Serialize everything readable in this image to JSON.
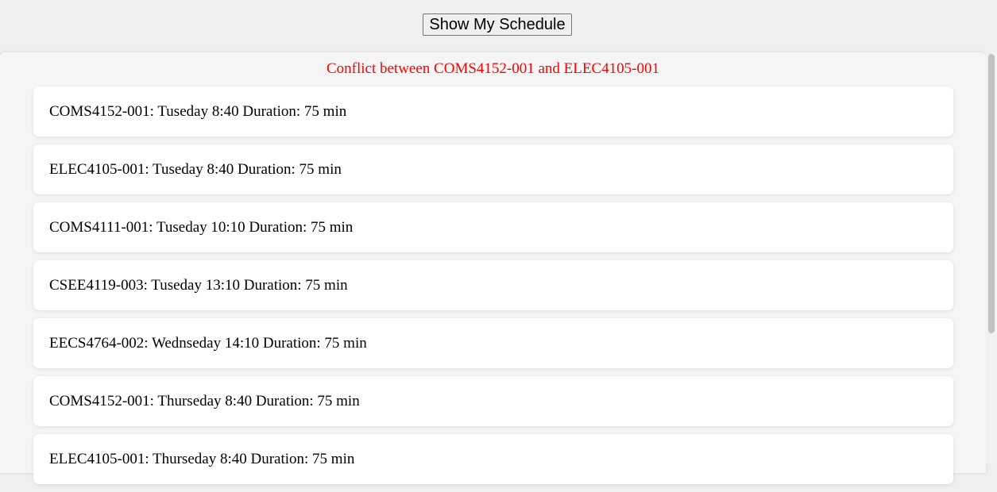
{
  "header": {
    "show_schedule_label": "Show My Schedule"
  },
  "schedule": {
    "conflict_message": "Conflict between COMS4152-001 and ELEC4105-001",
    "courses": [
      {
        "text": "COMS4152-001: Tuseday 8:40 Duration: 75 min"
      },
      {
        "text": "ELEC4105-001: Tuseday 8:40 Duration: 75 min"
      },
      {
        "text": "COMS4111-001: Tuseday 10:10 Duration: 75 min"
      },
      {
        "text": "CSEE4119-003: Tuseday 13:10 Duration: 75 min"
      },
      {
        "text": "EECS4764-002: Wednseday 14:10 Duration: 75 min"
      },
      {
        "text": "COMS4152-001: Thurseday 8:40 Duration: 75 min"
      },
      {
        "text": "ELEC4105-001: Thurseday 8:40 Duration: 75 min"
      }
    ]
  },
  "colors": {
    "conflict_text": "#ff0000",
    "page_background": "#efefef",
    "card_background": "#ffffff"
  }
}
